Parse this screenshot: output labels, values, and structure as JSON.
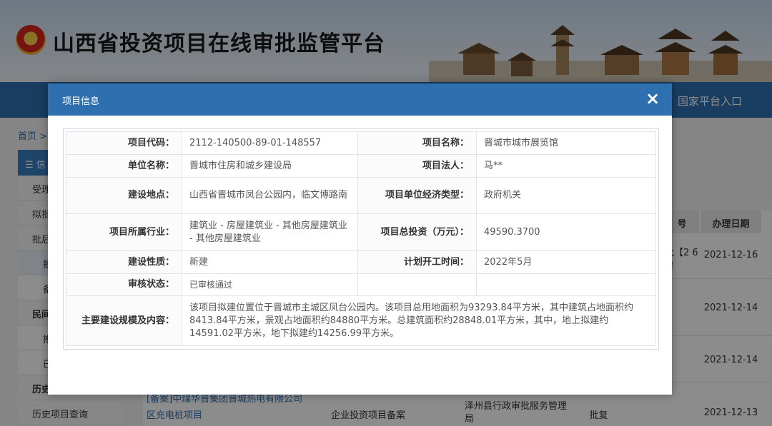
{
  "header": {
    "title": "山西省投资项目在线审批监管平台",
    "national_link": "国家平台入口"
  },
  "breadcrumb": "首页 >",
  "sidebar": {
    "section": "信",
    "items": [
      "受理",
      "拟批",
      "批后",
      "批",
      "备",
      "民间",
      "推",
      "已",
      "历史",
      "历史项目查询"
    ]
  },
  "bg_table": {
    "headers": [
      "号",
      "办理日期"
    ],
    "rows": [
      {
        "doc": "批【2\n6号",
        "date": "2021-12-16"
      },
      {
        "doc": "",
        "date": "2021-12-14"
      },
      {
        "doc": "",
        "date": "2021-12-14"
      },
      {
        "name1": "[备案]中煤华晋集团晋城热电有限公司",
        "name2": "区充电桩项目",
        "type": "企业投资项目备案",
        "dept": "泽州县行政审批服务管理局",
        "result": "批复",
        "date": "2021-12-13"
      }
    ]
  },
  "modal": {
    "title": "项目信息",
    "close_icon": "×",
    "fields": {
      "code_label": "项目代码：",
      "code": "2112-140500-89-01-148557",
      "name_label": "项目名称：",
      "name": "晋城市城市展览馆",
      "unit_label": "单位名称：",
      "unit": "晋城市住房和城乡建设局",
      "legal_label": "项目法人：",
      "legal": "马**",
      "site_label": "建设地点：",
      "site": "山西省晋城市凤台公园内，临文博路南",
      "econ_label": "项目单位经济类型：",
      "econ": "政府机关",
      "industry_label": "项目所属行业：",
      "industry": "建筑业 - 房屋建筑业 - 其他房屋建筑业 - 其他房屋建筑业",
      "invest_label": "项目总投资（万元）：",
      "invest": "49590.3700",
      "nature_label": "建设性质：",
      "nature": "新建",
      "start_label": "计划开工时间：",
      "start": "2022年5月",
      "status_label": "审核状态：",
      "status": "已审核通过",
      "scale_label": "主要建设规模及内容：",
      "scale": "该项目拟建位置位于晋城市主城区凤台公园内。该项目总用地面积为93293.84平方米，其中建筑占地面积约8413.84平方米，景观占地面积约84880平方米。总建筑面积约28848.01平方米，其中，地上拟建约14591.02平方米，地下拟建约14256.99平方米。"
    }
  }
}
